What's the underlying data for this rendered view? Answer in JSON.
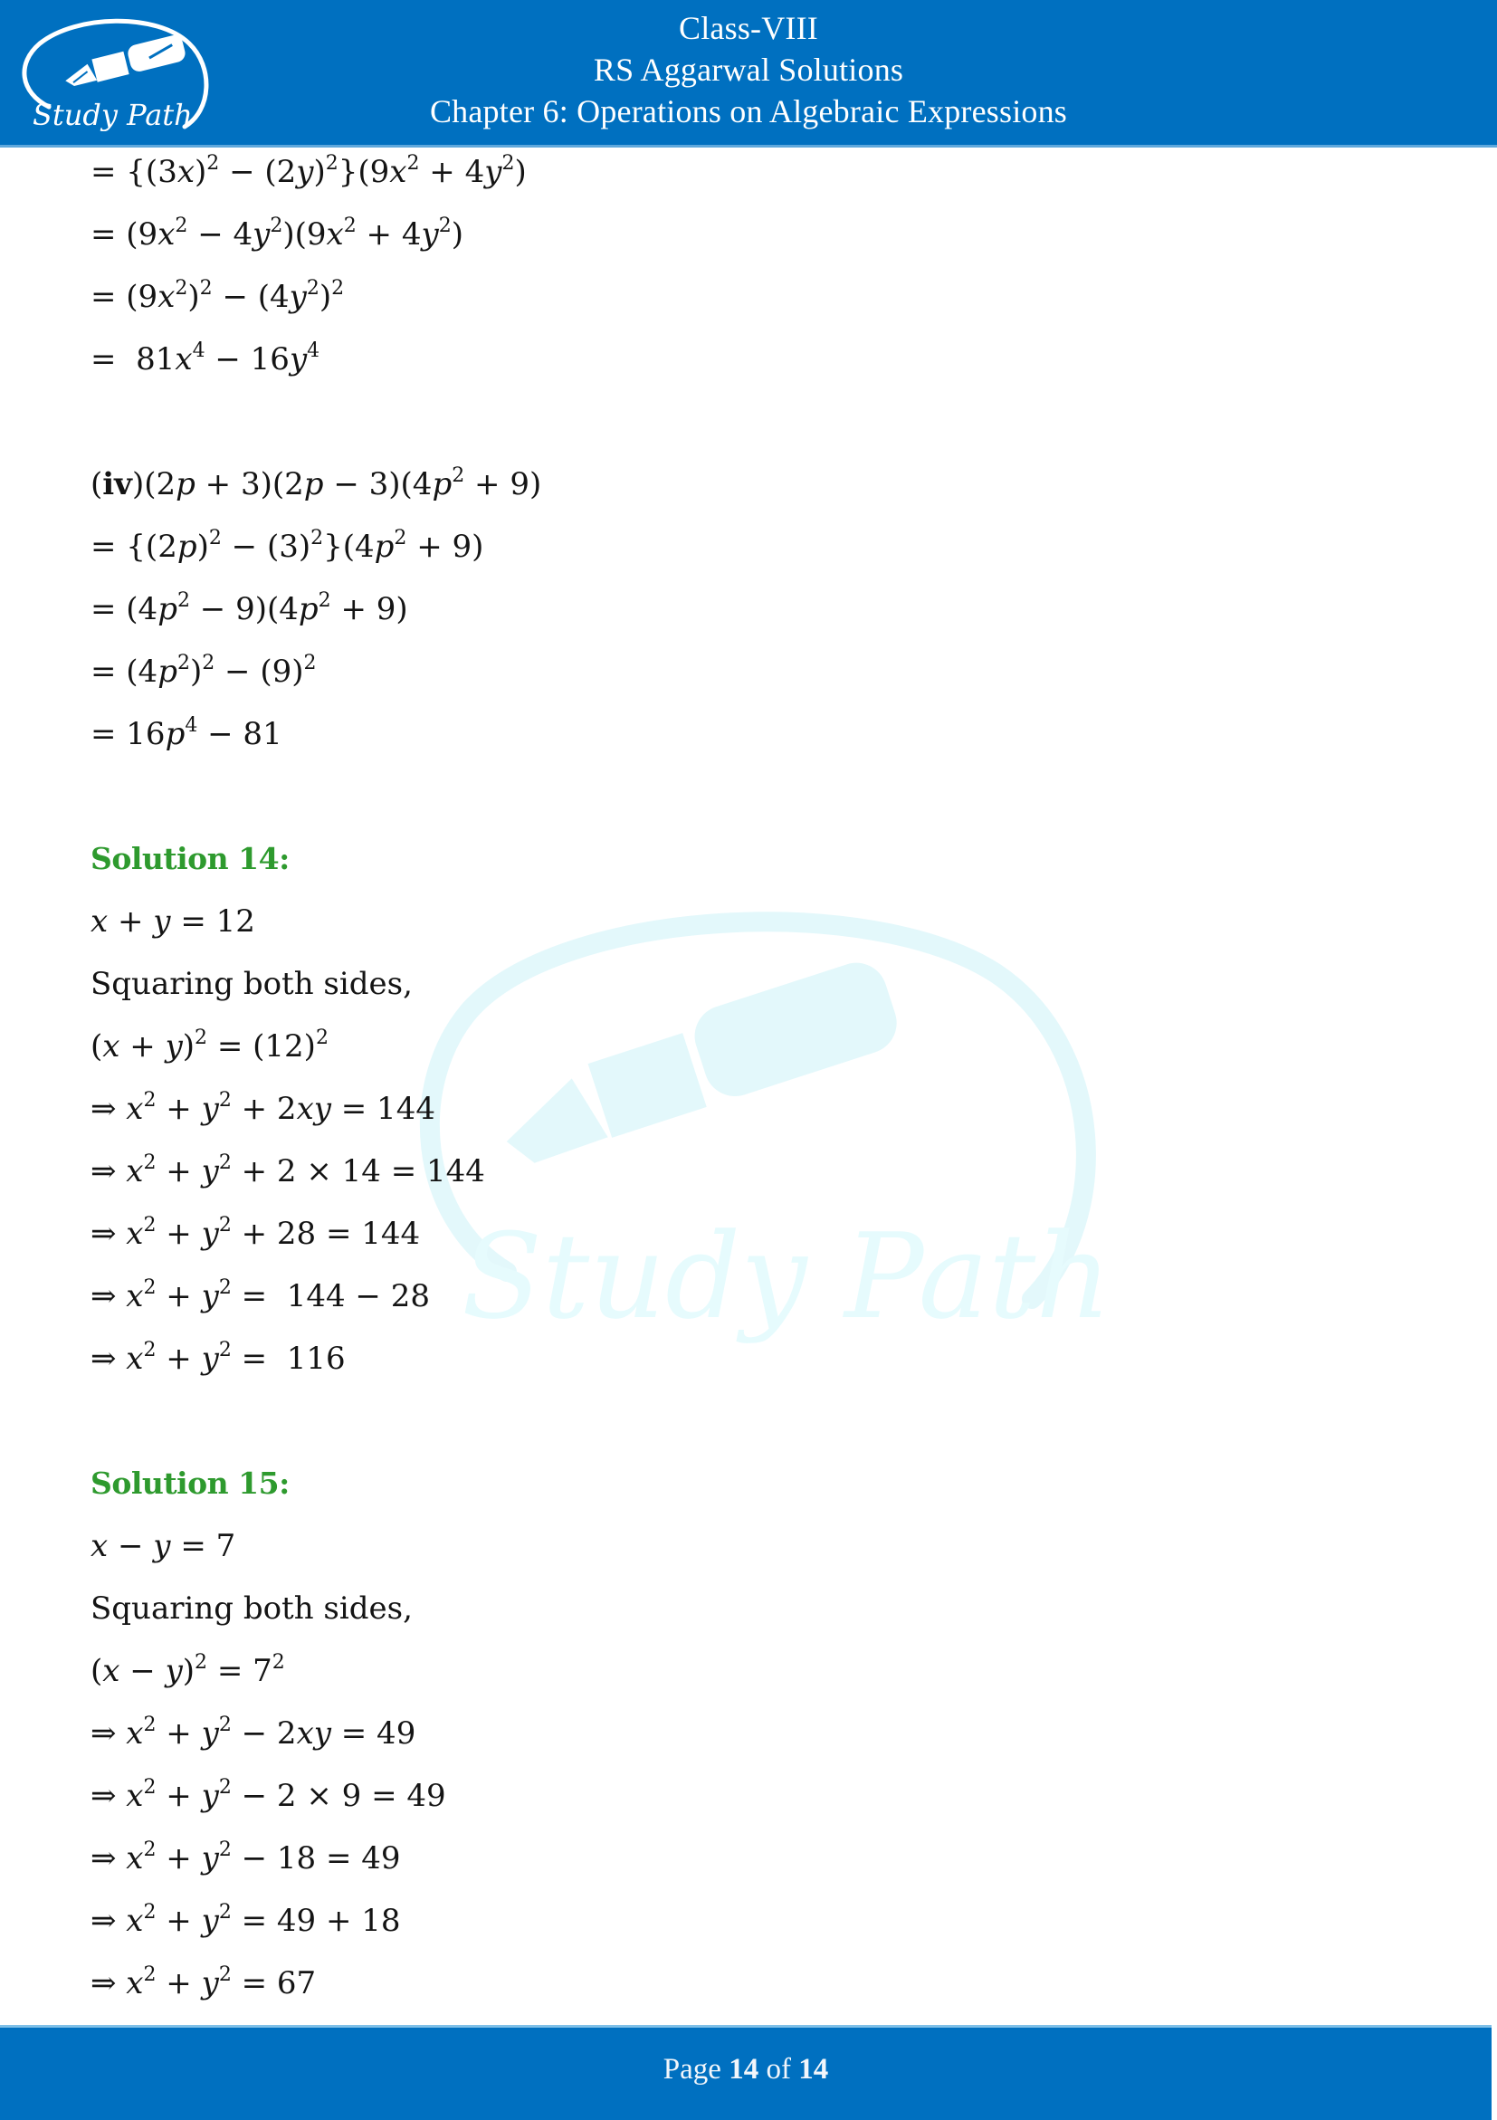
{
  "header": {
    "logo_text": "Study Path",
    "title_line1": "Class-VIII",
    "title_line2": "RS Aggarwal Solutions",
    "title_line3": "Chapter 6: Operations on Algebraic Expressions",
    "background_color": "#0070c0"
  },
  "watermark": {
    "text": "Study Path",
    "icon": "fountain-pen-icon"
  },
  "sections": [
    {
      "id": "part-iii-continued",
      "heading": null,
      "lines": [
        [
          [
            "t",
            "= {(3"
          ],
          [
            "i",
            "x"
          ],
          [
            "t",
            ")"
          ],
          [
            "s",
            "2"
          ],
          [
            "t",
            " − (2"
          ],
          [
            "i",
            "y"
          ],
          [
            "t",
            ")"
          ],
          [
            "s",
            "2"
          ],
          [
            "t",
            "}(9"
          ],
          [
            "i",
            "x"
          ],
          [
            "s",
            "2"
          ],
          [
            "t",
            " + 4"
          ],
          [
            "i",
            "y"
          ],
          [
            "s",
            "2"
          ],
          [
            "t",
            ")"
          ]
        ],
        [
          [
            "t",
            "= (9"
          ],
          [
            "i",
            "x"
          ],
          [
            "s",
            "2"
          ],
          [
            "t",
            " − 4"
          ],
          [
            "i",
            "y"
          ],
          [
            "s",
            "2"
          ],
          [
            "t",
            ")(9"
          ],
          [
            "i",
            "x"
          ],
          [
            "s",
            "2"
          ],
          [
            "t",
            " + 4"
          ],
          [
            "i",
            "y"
          ],
          [
            "s",
            "2"
          ],
          [
            "t",
            ")"
          ]
        ],
        [
          [
            "t",
            "= (9"
          ],
          [
            "i",
            "x"
          ],
          [
            "s",
            "2"
          ],
          [
            "t",
            ")"
          ],
          [
            "s",
            "2"
          ],
          [
            "t",
            " − (4"
          ],
          [
            "i",
            "y"
          ],
          [
            "s",
            "2"
          ],
          [
            "t",
            ")"
          ],
          [
            "s",
            "2"
          ]
        ],
        [
          [
            "t",
            "=  81"
          ],
          [
            "i",
            "x"
          ],
          [
            "s",
            "4"
          ],
          [
            "t",
            " − 16"
          ],
          [
            "i",
            "y"
          ],
          [
            "s",
            "4"
          ]
        ]
      ]
    },
    {
      "id": "part-iv",
      "heading": null,
      "lines": [
        [
          [
            "t",
            "("
          ],
          [
            "b",
            "iv"
          ],
          [
            "t",
            ")(2"
          ],
          [
            "i",
            "p"
          ],
          [
            "t",
            " + 3)(2"
          ],
          [
            "i",
            "p"
          ],
          [
            "t",
            " − 3)(4"
          ],
          [
            "i",
            "p"
          ],
          [
            "s",
            "2"
          ],
          [
            "t",
            " + 9)"
          ]
        ],
        [
          [
            "t",
            "= {(2"
          ],
          [
            "i",
            "p"
          ],
          [
            "t",
            ")"
          ],
          [
            "s",
            "2"
          ],
          [
            "t",
            " − (3)"
          ],
          [
            "s",
            "2"
          ],
          [
            "t",
            "}(4"
          ],
          [
            "i",
            "p"
          ],
          [
            "s",
            "2"
          ],
          [
            "t",
            " + 9)"
          ]
        ],
        [
          [
            "t",
            "= (4"
          ],
          [
            "i",
            "p"
          ],
          [
            "s",
            "2"
          ],
          [
            "t",
            " − 9)(4"
          ],
          [
            "i",
            "p"
          ],
          [
            "s",
            "2"
          ],
          [
            "t",
            " + 9)"
          ]
        ],
        [
          [
            "t",
            "= (4"
          ],
          [
            "i",
            "p"
          ],
          [
            "s",
            "2"
          ],
          [
            "t",
            ")"
          ],
          [
            "s",
            "2"
          ],
          [
            "t",
            " − (9)"
          ],
          [
            "s",
            "2"
          ]
        ],
        [
          [
            "t",
            "= 16"
          ],
          [
            "i",
            "p"
          ],
          [
            "s",
            "4"
          ],
          [
            "t",
            " − 81"
          ]
        ]
      ]
    },
    {
      "id": "solution-14",
      "heading": "Solution 14:",
      "lines": [
        [
          [
            "i",
            "x"
          ],
          [
            "t",
            " + "
          ],
          [
            "i",
            "y"
          ],
          [
            "t",
            " = 12"
          ]
        ],
        [
          [
            "t",
            "Squaring both sides,"
          ]
        ],
        [
          [
            "t",
            "("
          ],
          [
            "i",
            "x"
          ],
          [
            "t",
            " + "
          ],
          [
            "i",
            "y"
          ],
          [
            "t",
            ")"
          ],
          [
            "s",
            "2"
          ],
          [
            "t",
            " = (12)"
          ],
          [
            "s",
            "2"
          ]
        ],
        [
          [
            "t",
            "⇒ "
          ],
          [
            "i",
            "x"
          ],
          [
            "s",
            "2"
          ],
          [
            "t",
            " + "
          ],
          [
            "i",
            "y"
          ],
          [
            "s",
            "2"
          ],
          [
            "t",
            " + 2"
          ],
          [
            "i",
            "xy"
          ],
          [
            "t",
            " = 144"
          ]
        ],
        [
          [
            "t",
            "⇒ "
          ],
          [
            "i",
            "x"
          ],
          [
            "s",
            "2"
          ],
          [
            "t",
            " + "
          ],
          [
            "i",
            "y"
          ],
          [
            "s",
            "2"
          ],
          [
            "t",
            " + 2 × 14 = 144"
          ]
        ],
        [
          [
            "t",
            "⇒ "
          ],
          [
            "i",
            "x"
          ],
          [
            "s",
            "2"
          ],
          [
            "t",
            " + "
          ],
          [
            "i",
            "y"
          ],
          [
            "s",
            "2"
          ],
          [
            "t",
            " + 28 = 144"
          ]
        ],
        [
          [
            "t",
            "⇒ "
          ],
          [
            "i",
            "x"
          ],
          [
            "s",
            "2"
          ],
          [
            "t",
            " + "
          ],
          [
            "i",
            "y"
          ],
          [
            "s",
            "2"
          ],
          [
            "t",
            " =  144 − 28"
          ]
        ],
        [
          [
            "t",
            "⇒ "
          ],
          [
            "i",
            "x"
          ],
          [
            "s",
            "2"
          ],
          [
            "t",
            " + "
          ],
          [
            "i",
            "y"
          ],
          [
            "s",
            "2"
          ],
          [
            "t",
            " =  116"
          ]
        ]
      ]
    },
    {
      "id": "solution-15",
      "heading": "Solution 15:",
      "lines": [
        [
          [
            "i",
            "x"
          ],
          [
            "t",
            " − "
          ],
          [
            "i",
            "y"
          ],
          [
            "t",
            " = 7"
          ]
        ],
        [
          [
            "t",
            "Squaring both sides,"
          ]
        ],
        [
          [
            "t",
            "("
          ],
          [
            "i",
            "x"
          ],
          [
            "t",
            " − "
          ],
          [
            "i",
            "y"
          ],
          [
            "t",
            ")"
          ],
          [
            "s",
            "2"
          ],
          [
            "t",
            " = 7"
          ],
          [
            "s",
            "2"
          ]
        ],
        [
          [
            "t",
            "⇒ "
          ],
          [
            "i",
            "x"
          ],
          [
            "s",
            "2"
          ],
          [
            "t",
            " + "
          ],
          [
            "i",
            "y"
          ],
          [
            "s",
            "2"
          ],
          [
            "t",
            " − 2"
          ],
          [
            "i",
            "xy"
          ],
          [
            "t",
            " = 49"
          ]
        ],
        [
          [
            "t",
            "⇒ "
          ],
          [
            "i",
            "x"
          ],
          [
            "s",
            "2"
          ],
          [
            "t",
            " + "
          ],
          [
            "i",
            "y"
          ],
          [
            "s",
            "2"
          ],
          [
            "t",
            " − 2 × 9 = 49"
          ]
        ],
        [
          [
            "t",
            "⇒ "
          ],
          [
            "i",
            "x"
          ],
          [
            "s",
            "2"
          ],
          [
            "t",
            " + "
          ],
          [
            "i",
            "y"
          ],
          [
            "s",
            "2"
          ],
          [
            "t",
            " − 18 = 49"
          ]
        ],
        [
          [
            "t",
            "⇒ "
          ],
          [
            "i",
            "x"
          ],
          [
            "s",
            "2"
          ],
          [
            "t",
            " + "
          ],
          [
            "i",
            "y"
          ],
          [
            "s",
            "2"
          ],
          [
            "t",
            " = 49 + 18"
          ]
        ],
        [
          [
            "t",
            "⇒ "
          ],
          [
            "i",
            "x"
          ],
          [
            "s",
            "2"
          ],
          [
            "t",
            " + "
          ],
          [
            "i",
            "y"
          ],
          [
            "s",
            "2"
          ],
          [
            "t",
            " = 67"
          ]
        ]
      ]
    }
  ],
  "footer": {
    "page_prefix": "Page",
    "current_page": "14",
    "page_separator": "of",
    "total_pages": "14"
  },
  "colors": {
    "brand_blue": "#0070c0",
    "heading_green": "#2e9a2e",
    "watermark_cyan": "#e6fbfd"
  }
}
